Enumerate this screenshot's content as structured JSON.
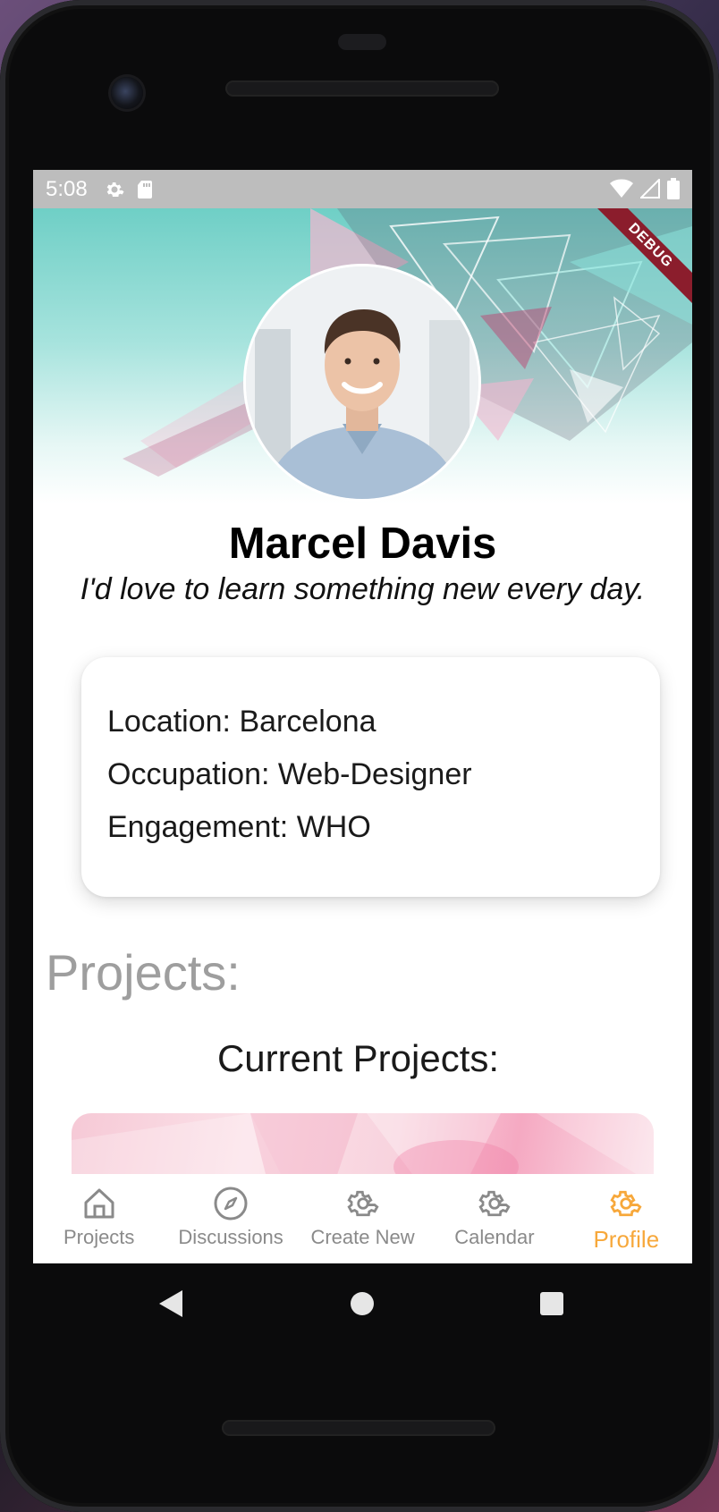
{
  "status_bar": {
    "time": "5:08",
    "left_icons": [
      "settings-icon",
      "sd-card-icon"
    ],
    "right_icons": [
      "wifi-icon",
      "signal-icon",
      "battery-icon"
    ]
  },
  "debug_banner": "DEBUG",
  "profile": {
    "name": "Marcel Davis",
    "tagline": "I'd love to learn something new every day.",
    "details": [
      "Location: Barcelona",
      "Occupation: Web-Designer",
      "Engagement: WHO"
    ]
  },
  "projects": {
    "heading": "Projects:",
    "current_heading": "Current Projects:"
  },
  "bottom_nav": {
    "items": [
      {
        "label": "Projects",
        "icon": "home-icon",
        "active": false
      },
      {
        "label": "Discussions",
        "icon": "compass-icon",
        "active": false
      },
      {
        "label": "Create New",
        "icon": "gear-icon",
        "active": false
      },
      {
        "label": "Calendar",
        "icon": "gear-icon",
        "active": false
      },
      {
        "label": "Profile",
        "icon": "gear-icon",
        "active": true
      }
    ]
  },
  "colors": {
    "accent": "#f7a83b",
    "inactive": "#8a8a8a",
    "header_teal": "#6fcfc6",
    "debug_ribbon": "#8b1d2c"
  },
  "system_nav": [
    "back-icon",
    "home-circle-icon",
    "recents-icon"
  ]
}
